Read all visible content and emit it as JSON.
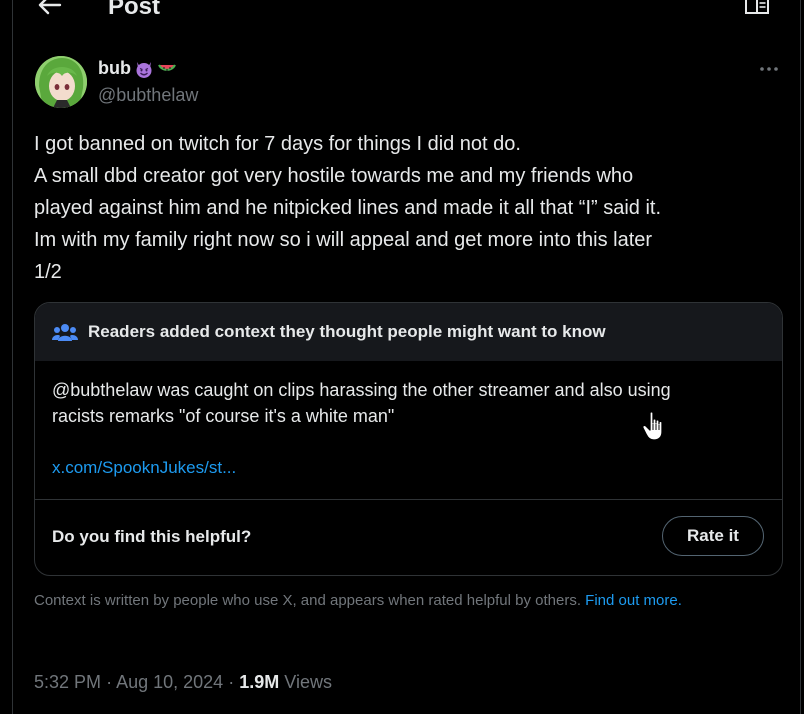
{
  "header": {
    "title": "Post"
  },
  "author": {
    "display_name": "bub",
    "handle": "@bubthelaw"
  },
  "tweet": {
    "lines": [
      "I got banned on twitch for 7 days for things I did not do.",
      "A small dbd creator got very hostile towards me and my friends who",
      "played against him and he nitpicked lines and made it all that “I” said it.",
      "Im with my family right now so i will appeal and get more into this later",
      "1/2"
    ]
  },
  "community_note": {
    "heading": "Readers added context they thought people might want to know",
    "body_lines": [
      "@bubthelaw was caught on clips harassing the other streamer and also using",
      "racists remarks \"of course it's a white man\""
    ],
    "link": "x.com/SpooknJukes/st...",
    "helpful_question": "Do you find this helpful?",
    "rate_label": "Rate it"
  },
  "disclaimer": {
    "text": "Context is written by people who use X, and appears when rated helpful by others.",
    "link": "Find out more."
  },
  "meta": {
    "time": "5:32 PM",
    "separator": "·",
    "date": "Aug 10, 2024",
    "views_count": "1.9M",
    "views_label": "Views"
  },
  "icons": {
    "back": "arrow-left-icon",
    "reader": "reader-mode-icon",
    "more": "more-horizontal-icon",
    "people": "people-icon",
    "emoji_1": "smiling-devil-emoji",
    "emoji_2": "watermelon-emoji",
    "cursor": "hand-cursor-icon"
  },
  "colors": {
    "background": "#000000",
    "text": "#e7e9ea",
    "secondary_text": "#71767b",
    "link": "#1d9bf0",
    "border": "#2f3336",
    "note_header_bg": "#16181c"
  }
}
